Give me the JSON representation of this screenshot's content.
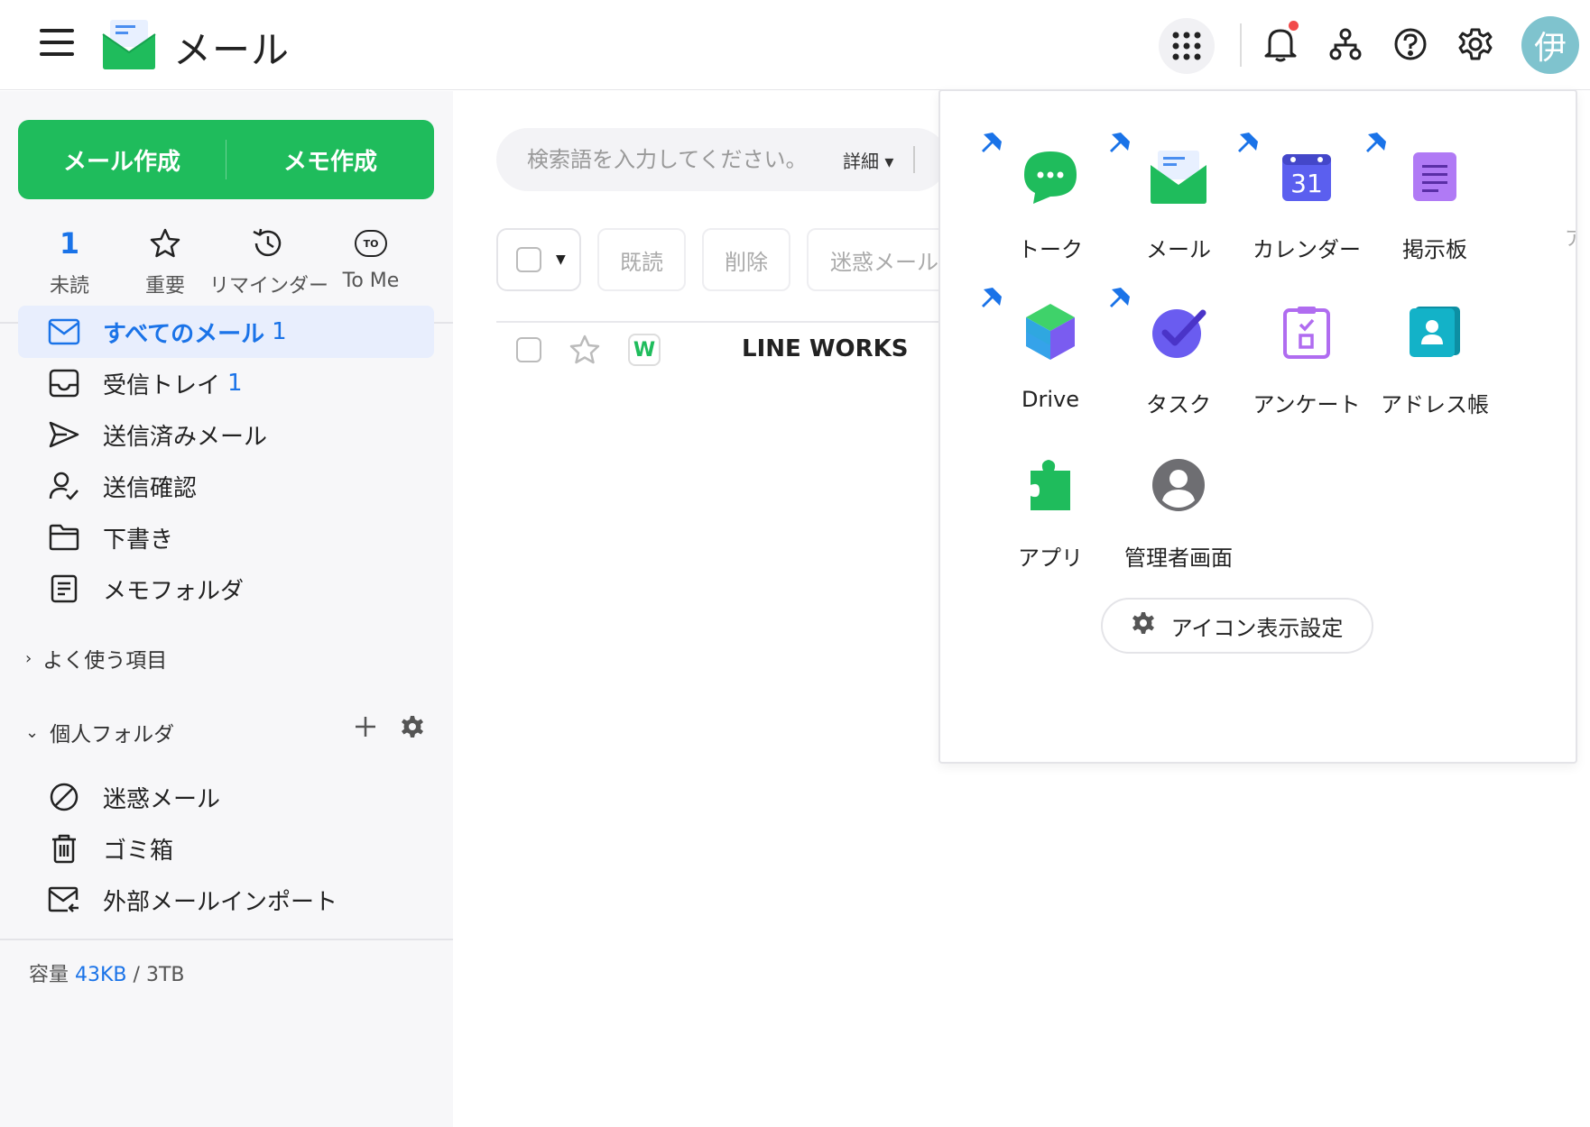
{
  "header": {
    "title": "メール",
    "avatar_text": "伊",
    "icons": [
      "menu-icon",
      "apps-grid-icon",
      "bell-icon",
      "org-chart-icon",
      "help-icon",
      "gear-icon"
    ]
  },
  "sidebar": {
    "compose_mail": "メール作成",
    "compose_memo": "メモ作成",
    "quick": {
      "unread_count": "1",
      "unread_label": "未読",
      "important_label": "重要",
      "reminder_label": "リマインダー",
      "tome_label": "To Me",
      "tome_badge": "TO"
    },
    "folders": [
      {
        "label": "すべてのメール",
        "count": "1"
      },
      {
        "label": "受信トレイ",
        "count": "1"
      },
      {
        "label": "送信済みメール"
      },
      {
        "label": "送信確認"
      },
      {
        "label": "下書き"
      },
      {
        "label": "メモフォルダ"
      }
    ],
    "favorites_section": "よく使う項目",
    "personal_section": "個人フォルダ",
    "personal_folders": [
      {
        "label": "迷惑メール"
      },
      {
        "label": "ゴミ箱"
      },
      {
        "label": "外部メールインポート"
      }
    ],
    "storage": {
      "label": "容量",
      "used": "43KB",
      "separator": "/",
      "total": "3TB"
    }
  },
  "main": {
    "search_placeholder": "検索語を入力してください。",
    "search_detail": "詳細",
    "toolbar": {
      "read": "既読",
      "delete": "削除",
      "spam": "迷惑メール"
    },
    "mail": {
      "sender": "LINE WORKS",
      "logo_letter": "W"
    }
  },
  "apps_popup": {
    "apps": [
      {
        "label": "トーク",
        "icon": "talk-icon",
        "color": "#1fbc5c"
      },
      {
        "label": "メール",
        "icon": "mail-icon",
        "color": "#1fbc5c"
      },
      {
        "label": "カレンダー",
        "icon": "calendar-icon",
        "color": "#5b5fef",
        "day": "31"
      },
      {
        "label": "掲示板",
        "icon": "board-icon",
        "color": "#a46cf0"
      },
      {
        "label": "Drive",
        "icon": "drive-icon"
      },
      {
        "label": "タスク",
        "icon": "task-icon",
        "color": "#6a5cf0"
      },
      {
        "label": "アンケート",
        "icon": "survey-icon",
        "color": "#b06cf0"
      },
      {
        "label": "アドレス帳",
        "icon": "address-book-icon",
        "color": "#13b2c8"
      },
      {
        "label": "アプリ",
        "icon": "app-puzzle-icon",
        "color": "#1fbc5c"
      },
      {
        "label": "管理者画面",
        "icon": "admin-icon",
        "color": "#777"
      }
    ],
    "icon_settings_label": "アイコン表示設定",
    "edge_text": "ア"
  },
  "colors": {
    "brand_green": "#1fbc5c",
    "accent_blue": "#1a73e8",
    "pin_blue": "#1a73e8"
  }
}
